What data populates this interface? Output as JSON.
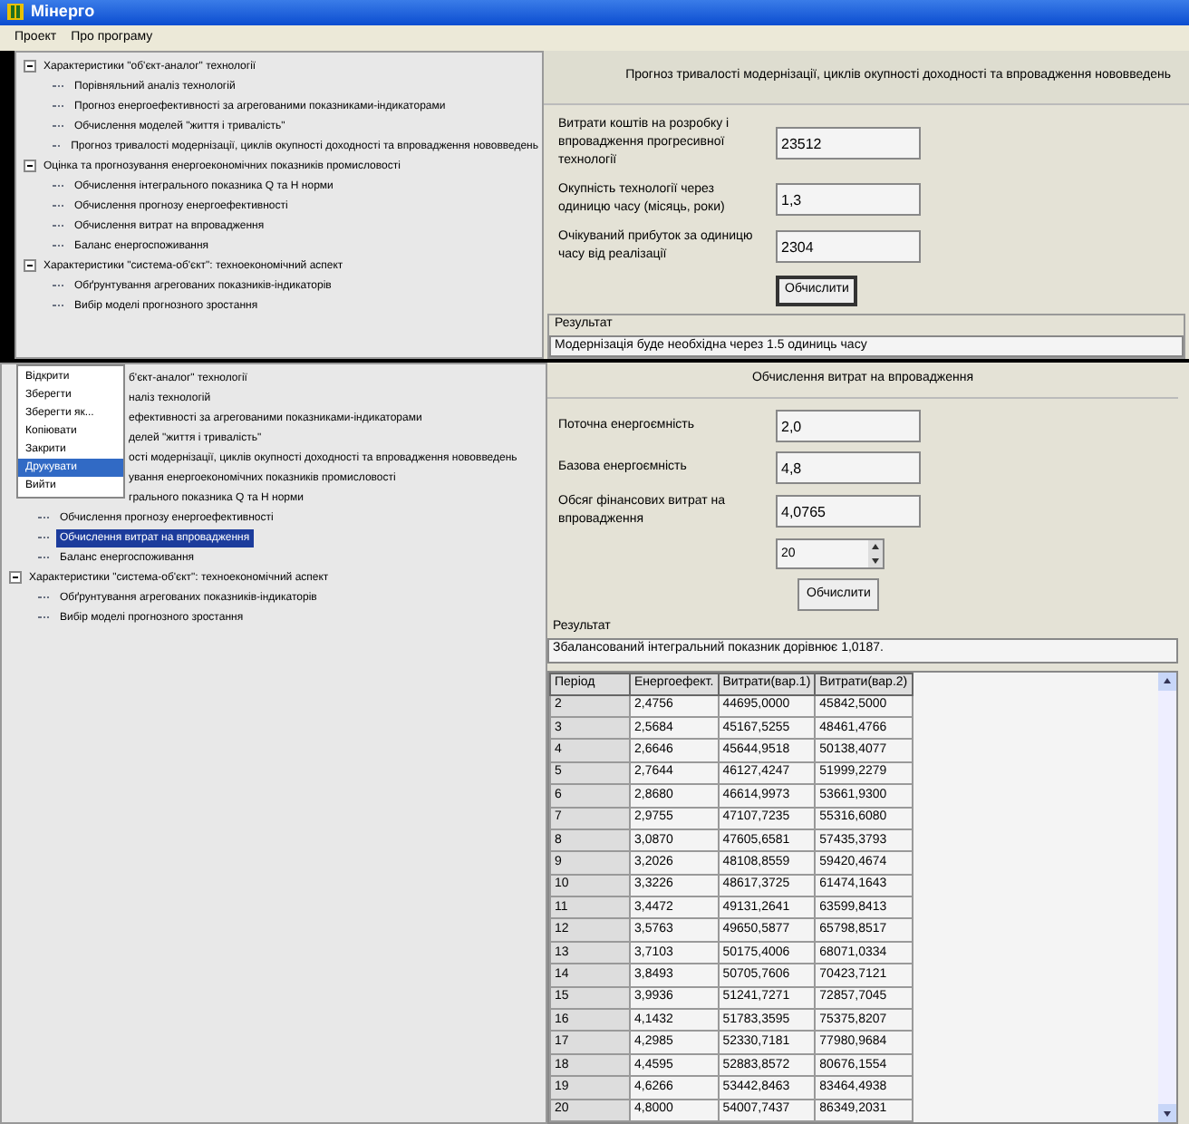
{
  "window": {
    "title": "Мінерго"
  },
  "menu_bar": [
    "Проект",
    "Про програму"
  ],
  "top_view": {
    "tree": [
      {
        "label": "Характеристики \"об'єкт-аналог\" технології",
        "expanded": true,
        "selected": false,
        "children": [
          {
            "label": "Порівняльний аналіз технологій",
            "selected": false
          },
          {
            "label": "Прогноз енергоефективності за агрегованими показниками-індикаторами",
            "selected": false
          },
          {
            "label": "Обчислення моделей \"життя і тривалість\"",
            "selected": false
          },
          {
            "label": "Прогноз тривалості модернізації, циклів окупності доходності та впровадження нововведень",
            "selected": false
          }
        ]
      },
      {
        "label": "Оцінка та прогнозування енергоекономічних показників промисловості",
        "expanded": true,
        "selected": false,
        "children": [
          {
            "label": "Обчислення інтегрального показника Q та H норми",
            "selected": false
          },
          {
            "label": "Обчислення прогнозу енергоефективності",
            "selected": false
          },
          {
            "label": "Обчислення витрат на впровадження",
            "selected": false
          },
          {
            "label": "Баланс енергоспоживання",
            "selected": false
          }
        ]
      },
      {
        "label": "Характеристики \"система-об'єкт\": техноекономічний аспект",
        "expanded": true,
        "selected": false,
        "children": [
          {
            "label": "Обґрунтування агрегованих показників-індикаторів",
            "selected": false
          },
          {
            "label": "Вибір моделі прогнозного зростання",
            "selected": false
          }
        ]
      }
    ],
    "form": {
      "header": "Прогноз тривалості модернізації, циклів окупності доходності та впровадження нововведень",
      "fields": [
        {
          "label": "Витрати коштів на розробку і впровадження прогресивної технології",
          "value": "23512"
        },
        {
          "label": "Окупність технології через одиницю часу (місяць, роки)",
          "value": "1,3"
        },
        {
          "label": "Очікуваний прибуток за одиницю часу від реалізації",
          "value": "2304"
        }
      ],
      "button": "Обчислити",
      "result_title": "Результат",
      "result": "Модернізація буде необхідна через 1.5 одиниць часу"
    }
  },
  "bottom_view": {
    "tree": [
      {
        "label": "б'єкт-аналог\" технології",
        "clipped": true,
        "expanded": true,
        "selected": false,
        "children": [
          {
            "label": "наліз технологій",
            "clipped": true,
            "selected": false
          },
          {
            "label": "ефективності за агрегованими показниками-індикаторами",
            "clipped": true,
            "selected": false
          },
          {
            "label": "делей \"життя і тривалість\"",
            "clipped": true,
            "selected": false
          },
          {
            "label": "ості модернізації, циклів окупності доходності та впровадження нововведень",
            "clipped": true,
            "selected": false
          }
        ]
      },
      {
        "label": "ування енергоекономічних показників промисловості",
        "clipped": true,
        "expanded": true,
        "selected": false,
        "children": [
          {
            "label": "грального показника Q та H норми",
            "clipped": true,
            "selected": false
          },
          {
            "label": "Обчислення прогнозу енергоефективності",
            "clipped": false,
            "selected": false
          },
          {
            "label": "Обчислення витрат на впровадження",
            "clipped": false,
            "selected": true
          },
          {
            "label": "Баланс енергоспоживання",
            "clipped": false,
            "selected": false
          }
        ]
      },
      {
        "label": "Характеристики \"система-об'єкт\": техноекономічний аспект",
        "clipped": false,
        "expanded": true,
        "selected": false,
        "children": [
          {
            "label": "Обґрунтування агрегованих показників-індикаторів",
            "clipped": false,
            "selected": false
          },
          {
            "label": "Вибір моделі прогнозного зростання",
            "clipped": false,
            "selected": false
          }
        ]
      }
    ],
    "context_menu": [
      {
        "label": "Відкрити",
        "selected": false
      },
      {
        "label": "Зберегти",
        "selected": false
      },
      {
        "label": "Зберегти як...",
        "selected": false
      },
      {
        "label": "Копіювати",
        "selected": false
      },
      {
        "label": "Закрити",
        "selected": false
      },
      {
        "label": "Друкувати",
        "selected": true
      },
      {
        "label": "Вийти",
        "selected": false
      }
    ],
    "form": {
      "header": "Обчислення витрат на впровадження",
      "fields": [
        {
          "kind": "text",
          "label": "Поточна енергоємність",
          "value": "2,0"
        },
        {
          "kind": "text",
          "label": "Базова енергоємність",
          "value": "4,8"
        },
        {
          "kind": "text",
          "label": "Обсяг фінансових витрат на впровадження",
          "value": "4,0765"
        },
        {
          "kind": "spinner",
          "value": "20"
        }
      ],
      "button": "Обчислити",
      "result_title": "Результат",
      "result": "Збалансований інтегральний показник дорівнює 1,0187."
    },
    "table": {
      "columns": [
        "Період",
        "Енергоефект.",
        "Витрати(вар.1)",
        "Витрати(вар.2)"
      ],
      "rows": [
        [
          "2",
          "2,4756",
          "44695,0000",
          "45842,5000"
        ],
        [
          "3",
          "2,5684",
          "45167,5255",
          "48461,4766"
        ],
        [
          "4",
          "2,6646",
          "45644,9518",
          "50138,4077"
        ],
        [
          "5",
          "2,7644",
          "46127,4247",
          "51999,2279"
        ],
        [
          "6",
          "2,8680",
          "46614,9973",
          "53661,9300"
        ],
        [
          "7",
          "2,9755",
          "47107,7235",
          "55316,6080"
        ],
        [
          "8",
          "3,0870",
          "47605,6581",
          "57435,3793"
        ],
        [
          "9",
          "3,2026",
          "48108,8559",
          "59420,4674"
        ],
        [
          "10",
          "3,3226",
          "48617,3725",
          "61474,1643"
        ],
        [
          "11",
          "3,4472",
          "49131,2641",
          "63599,8413"
        ],
        [
          "12",
          "3,5763",
          "49650,5877",
          "65798,8517"
        ],
        [
          "13",
          "3,7103",
          "50175,4006",
          "68071,0334"
        ],
        [
          "14",
          "3,8493",
          "50705,7606",
          "70423,7121"
        ],
        [
          "15",
          "3,9936",
          "51241,7271",
          "72857,7045"
        ],
        [
          "16",
          "4,1432",
          "51783,3595",
          "75375,8207"
        ],
        [
          "17",
          "4,2985",
          "52330,7181",
          "77980,9684"
        ],
        [
          "18",
          "4,4595",
          "52883,8572",
          "80676,1554"
        ],
        [
          "19",
          "4,6266",
          "53442,8463",
          "83464,4938"
        ],
        [
          "20",
          "4,8000",
          "54007,7437",
          "86349,2031"
        ]
      ]
    }
  }
}
